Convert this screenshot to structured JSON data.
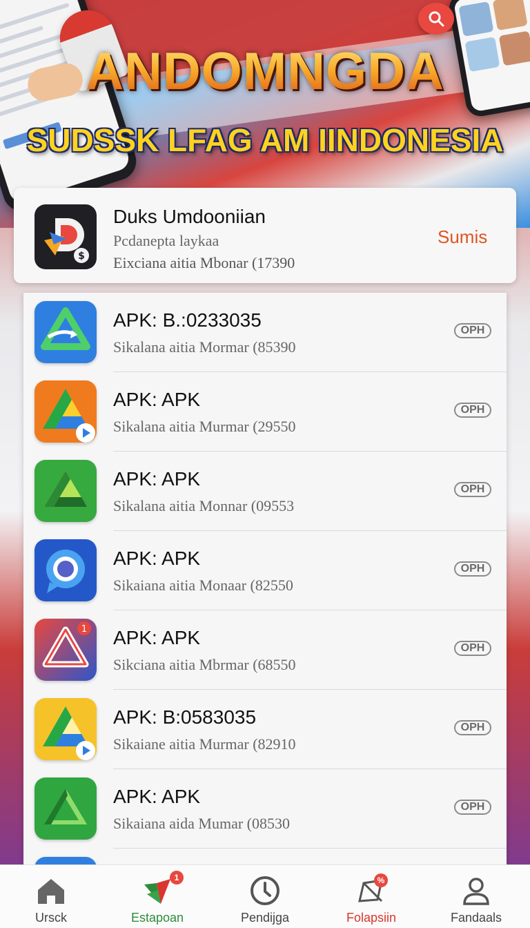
{
  "banner": {
    "title": "ANDOMNGDA",
    "subtitle": "SUDSSK LFAG AM IINDONESIA"
  },
  "featured": {
    "title": "Duks Umdooniian",
    "subtitle": "Pcdanepta laykaa",
    "meta": "Eixciana aitia Mbonar (17390",
    "action_label": "Sumis",
    "icon": "app-d-icon"
  },
  "apps": [
    {
      "name": "APK: B.:0233035",
      "desc": "Sikalana aitia Mormar (85390",
      "button": "OPH",
      "icon": "drive-blue-icon"
    },
    {
      "name": "APK: APK",
      "desc": "Sikalana aitia Murmar (29550",
      "button": "OPH",
      "icon": "drive-play-icon"
    },
    {
      "name": "APK: APK",
      "desc": "Sikalana aitia Monnar (09553",
      "button": "OPH",
      "icon": "drive-green-icon"
    },
    {
      "name": "APK: APK",
      "desc": "Sikaiana aitia Monaar (82550",
      "button": "OPH",
      "icon": "chat-bubble-icon"
    },
    {
      "name": "APK: APK",
      "desc": "Sikciana aitia Mbrmar (68550",
      "button": "OPH",
      "icon": "drive-red-icon"
    },
    {
      "name": "APK: B:0583035",
      "desc": "Sikaiane aitia Murmar (82910",
      "button": "OPH",
      "icon": "drive-yellow-icon"
    },
    {
      "name": "APK: APK",
      "desc": "Sikaiana aida Mumar (08530",
      "button": "OPH",
      "icon": "drive-green-dark-icon"
    }
  ],
  "nav": [
    {
      "label": "Ursck",
      "icon": "home-icon",
      "color": "#444444"
    },
    {
      "label": "Estapoan",
      "icon": "leaf-icon",
      "color": "#2e8b3a",
      "badge": "1"
    },
    {
      "label": "Pendijga",
      "icon": "clock-play-icon",
      "color": "#444444"
    },
    {
      "label": "Folapsiin",
      "icon": "tag-icon",
      "color": "#d8362e",
      "badge": "%"
    },
    {
      "label": "Fandaals",
      "icon": "user-icon",
      "color": "#444444"
    }
  ],
  "colors": {
    "accent": "#e0541f",
    "active_nav": "#2e8b3a",
    "promo_nav": "#d8362e"
  }
}
